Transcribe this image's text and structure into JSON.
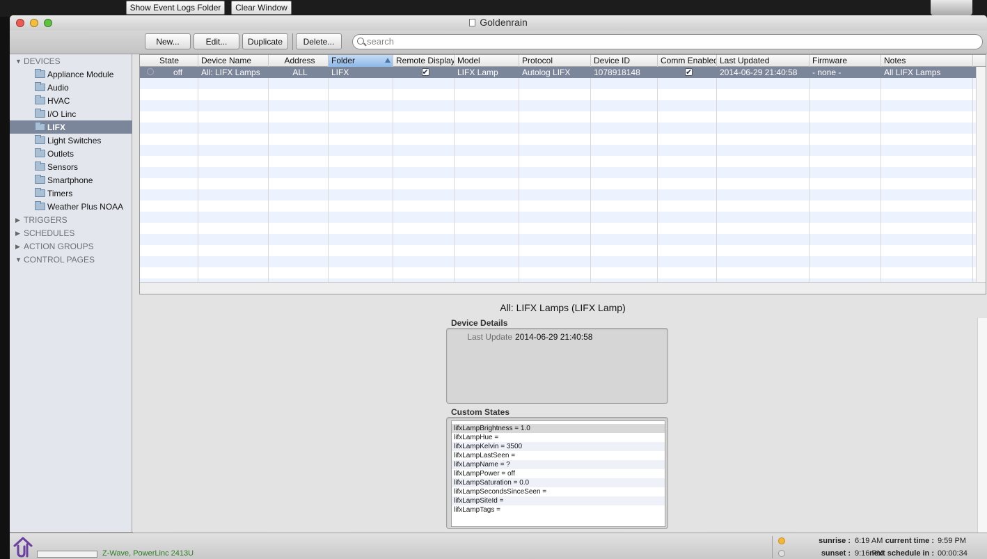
{
  "top_buttons": {
    "show_logs": "Show Event Logs Folder",
    "clear_window": "Clear Window"
  },
  "window": {
    "title": "Goldenrain"
  },
  "toolbar": {
    "new": "New...",
    "edit": "Edit...",
    "duplicate": "Duplicate",
    "delete": "Delete...",
    "search_placeholder": "search"
  },
  "sidebar": {
    "devices_label": "DEVICES",
    "folders": [
      "Appliance Module",
      "Audio",
      "HVAC",
      "I/O Linc",
      "LIFX",
      "Light Switches",
      "Outlets",
      "Sensors",
      "Smartphone",
      "Timers",
      "Weather Plus NOAA"
    ],
    "selected_folder": "LIFX",
    "categories": [
      "TRIGGERS",
      "SCHEDULES",
      "ACTION GROUPS",
      "CONTROL PAGES"
    ]
  },
  "table": {
    "columns": [
      "State",
      "Device Name",
      "Address",
      "Folder",
      "Remote Display",
      "Model",
      "Protocol",
      "Device ID",
      "Comm Enabled",
      "Last Updated",
      "Firmware",
      "Notes"
    ],
    "rows": [
      {
        "state": "off",
        "device_name": "All: LIFX Lamps",
        "address": "ALL",
        "folder": "LIFX",
        "remote_display": true,
        "model": "LIFX Lamp",
        "protocol": "Autolog LIFX",
        "device_id": "1078918148",
        "comm_enabled": true,
        "last_updated": "2014-06-29 21:40:58",
        "firmware": "- none -",
        "notes": "All LIFX Lamps"
      }
    ]
  },
  "detail": {
    "title": "All: LIFX Lamps (LIFX Lamp)",
    "device_details_label": "Device Details",
    "last_update_key": "Last Update",
    "last_update_value": "2014-06-29 21:40:58",
    "custom_states_label": "Custom States",
    "custom_states": [
      "lifxLampBrightness = 1.0",
      "lifxLampHue =",
      "lifxLampKelvin = 3500",
      "lifxLampLastSeen =",
      "lifxLampName = ?",
      "lifxLampPower = off",
      "lifxLampSaturation = 0.0",
      "lifxLampSecondsSinceSeen =",
      "lifxLampSiteId =",
      "lifxLampTags ="
    ]
  },
  "status": {
    "interface": "Z-Wave, PowerLinc 2413U",
    "sunrise_label": "sunrise :",
    "sunrise_value": "6:19 AM",
    "sunset_label": "sunset :",
    "sunset_value": "9:16 PM",
    "current_time_label": "current time :",
    "current_time_value": "9:59 PM",
    "next_schedule_label": "next schedule in :",
    "next_schedule_value": "00:00:34"
  },
  "colors": {
    "selection": "#7b869a",
    "status_green": "#2d7a22",
    "sorted_header": "#8db8e8"
  }
}
